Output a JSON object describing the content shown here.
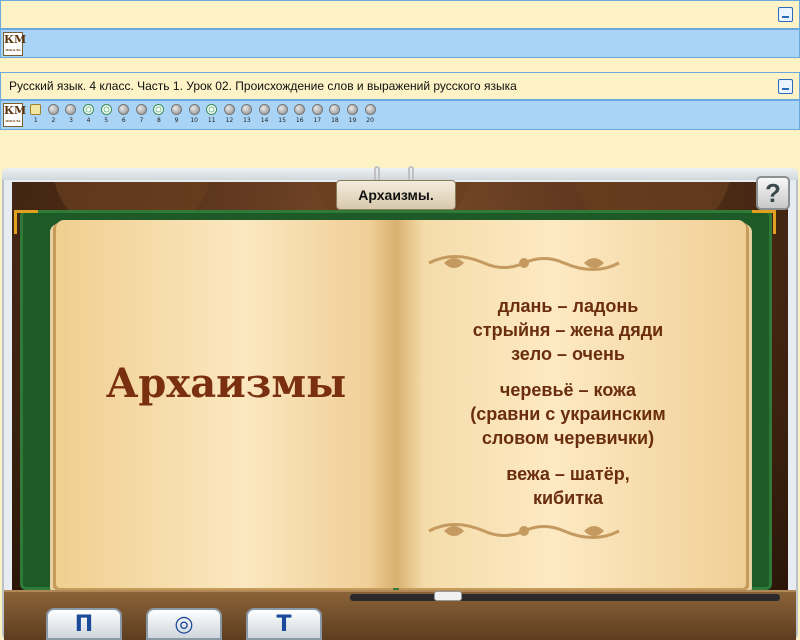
{
  "app": {
    "logo_text": "КМ",
    "logo_subtext": "школа"
  },
  "lesson": {
    "title": "Русский язык. 4 класс. Часть 1. Урок 02. Происхождение слов и выражений русского языка"
  },
  "lesson_nav": {
    "items": [
      {
        "num": "1",
        "state": "done"
      },
      {
        "num": "2",
        "state": "todo"
      },
      {
        "num": "3",
        "state": "todo"
      },
      {
        "num": "4",
        "state": "partial"
      },
      {
        "num": "5",
        "state": "partial"
      },
      {
        "num": "6",
        "state": "todo"
      },
      {
        "num": "7",
        "state": "todo"
      },
      {
        "num": "8",
        "state": "partial"
      },
      {
        "num": "9",
        "state": "todo"
      },
      {
        "num": "10",
        "state": "todo"
      },
      {
        "num": "11",
        "state": "partial"
      },
      {
        "num": "12",
        "state": "todo"
      },
      {
        "num": "13",
        "state": "todo"
      },
      {
        "num": "14",
        "state": "todo"
      },
      {
        "num": "15",
        "state": "todo"
      },
      {
        "num": "16",
        "state": "todo"
      },
      {
        "num": "17",
        "state": "todo"
      },
      {
        "num": "18",
        "state": "todo"
      },
      {
        "num": "19",
        "state": "todo"
      },
      {
        "num": "20",
        "state": "todo"
      }
    ]
  },
  "slide": {
    "tab_title": "Архаизмы.",
    "left_page_title": "Архаизмы",
    "right_page_lines": [
      "длань – ладонь",
      "стрыйня – жена дяди",
      "зело – очень",
      "",
      "черевьё –  кожа",
      "(сравни с украинским",
      "словом черевички)",
      "",
      "вежа – шатёр,",
      "кибитка"
    ]
  },
  "controls": {
    "help_label": "?",
    "prev_glyph": "П",
    "replay_glyph": "◎",
    "next_glyph": "Т"
  }
}
